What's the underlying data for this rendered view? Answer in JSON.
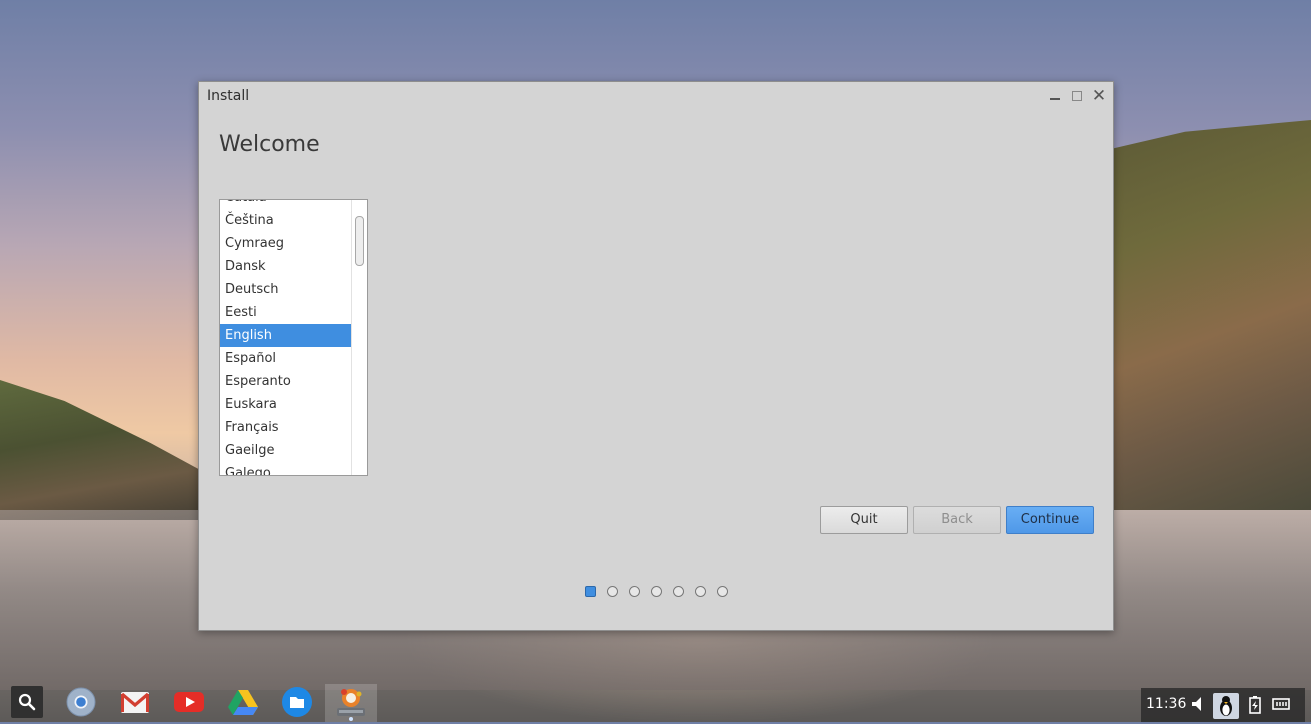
{
  "window": {
    "title": "Install",
    "controls": {
      "minimize": "minimize",
      "maximize": "maximize",
      "close": "✕"
    }
  },
  "page": {
    "heading": "Welcome"
  },
  "languages": {
    "items": [
      "Català",
      "Čeština",
      "Cymraeg",
      "Dansk",
      "Deutsch",
      "Eesti",
      "English",
      "Español",
      "Esperanto",
      "Euskara",
      "Français",
      "Gaeilge",
      "Galego"
    ],
    "selected": "English"
  },
  "buttons": {
    "quit": "Quit",
    "back": "Back",
    "continue": "Continue"
  },
  "steps": {
    "total": 7,
    "current": 1
  },
  "shelf": {
    "apps": [
      "launcher-search-icon",
      "chrome-icon",
      "gmail-icon",
      "youtube-icon",
      "drive-icon",
      "files-icon",
      "installer-icon"
    ]
  },
  "tray": {
    "time": "11:36"
  },
  "colors": {
    "accent": "#3f8ee0",
    "window_bg": "#d4d4d4"
  }
}
